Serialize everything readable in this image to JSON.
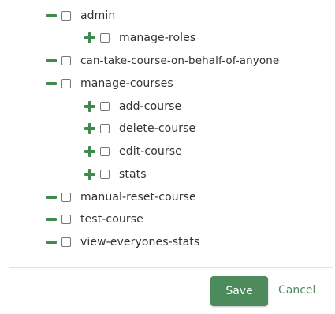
{
  "colors": {
    "accent": "#4d8a5c",
    "toggle": "#3f8a4e",
    "text": "#333333"
  },
  "tree": {
    "items": [
      {
        "label": "admin",
        "toggle": "minus-icon"
      },
      {
        "label": "manage-roles",
        "toggle": "plus-icon"
      },
      {
        "label": "can-take-course-on-behalf-of-anyone",
        "toggle": "minus-icon"
      },
      {
        "label": "manage-courses",
        "toggle": "minus-icon"
      },
      {
        "label": "add-course",
        "toggle": "plus-icon"
      },
      {
        "label": "delete-course",
        "toggle": "plus-icon"
      },
      {
        "label": "edit-course",
        "toggle": "plus-icon"
      },
      {
        "label": "stats",
        "toggle": "plus-icon"
      },
      {
        "label": "manual-reset-course",
        "toggle": "minus-icon"
      },
      {
        "label": "test-course",
        "toggle": "minus-icon"
      },
      {
        "label": "view-everyones-stats",
        "toggle": "minus-icon"
      }
    ]
  },
  "actions": {
    "save_label": "Save",
    "cancel_label": "Cancel"
  }
}
